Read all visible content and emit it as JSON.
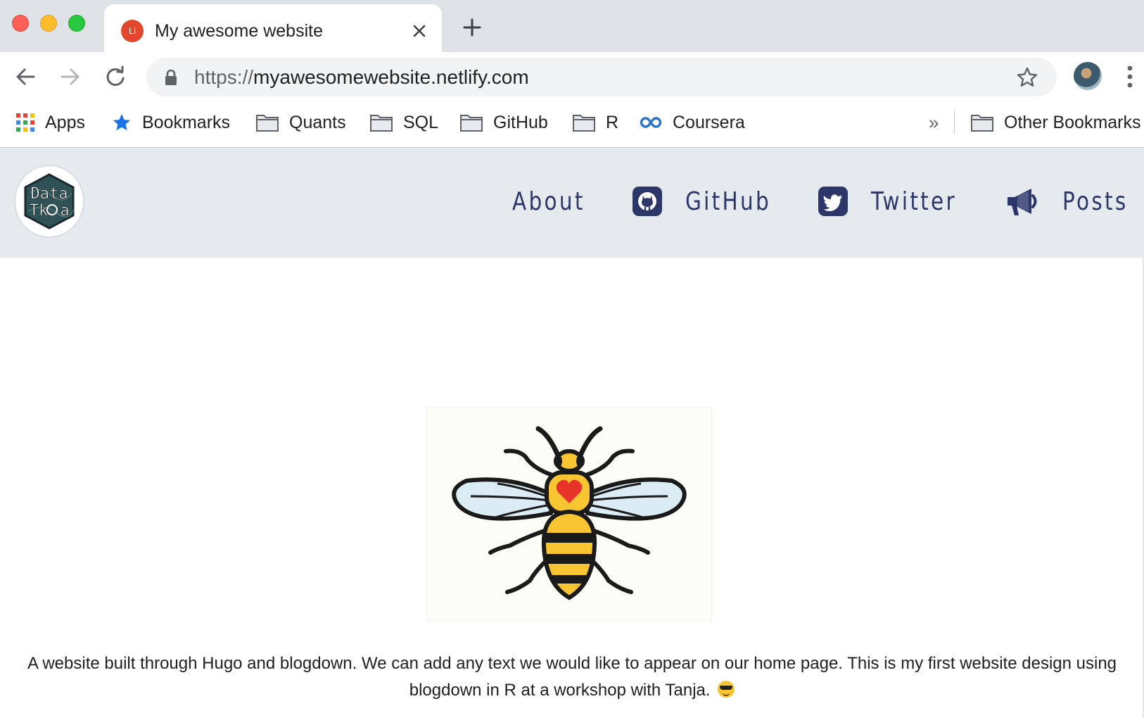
{
  "browser": {
    "tab": {
      "favicon_text": "Li",
      "title": "My awesome website"
    },
    "address": {
      "scheme": "https://",
      "host": "myawesomewebsite.netlify.com"
    },
    "bookmarks": [
      {
        "label": "Apps",
        "icon": "apps-grid-icon"
      },
      {
        "label": "Bookmarks",
        "icon": "star-icon"
      },
      {
        "label": "Quants",
        "icon": "folder-icon"
      },
      {
        "label": "SQL",
        "icon": "folder-icon"
      },
      {
        "label": "GitHub",
        "icon": "folder-icon"
      },
      {
        "label": "R",
        "icon": "folder-icon"
      },
      {
        "label": "Coursera",
        "icon": "coursera-icon"
      }
    ],
    "overflow_label": "»",
    "other_bookmarks": "Other Bookmarks"
  },
  "site": {
    "logo": {
      "line1": "Data",
      "line2": "Tk",
      "line2b": "a"
    },
    "nav": [
      {
        "label": "About",
        "icon": ""
      },
      {
        "label": "GitHub",
        "icon": "github-icon"
      },
      {
        "label": "Twitter",
        "icon": "twitter-icon"
      },
      {
        "label": "Posts",
        "icon": "megaphone-icon"
      }
    ],
    "intro_text": "A website built through Hugo and blogdown. We can add any text we would like to appear on our home page. This is my first website design using blogdown in R at a workshop with Tanja."
  },
  "colors": {
    "nav_text": "#2d3668",
    "header_bg": "#e5eaef",
    "tab_strip": "#dee1e6"
  }
}
